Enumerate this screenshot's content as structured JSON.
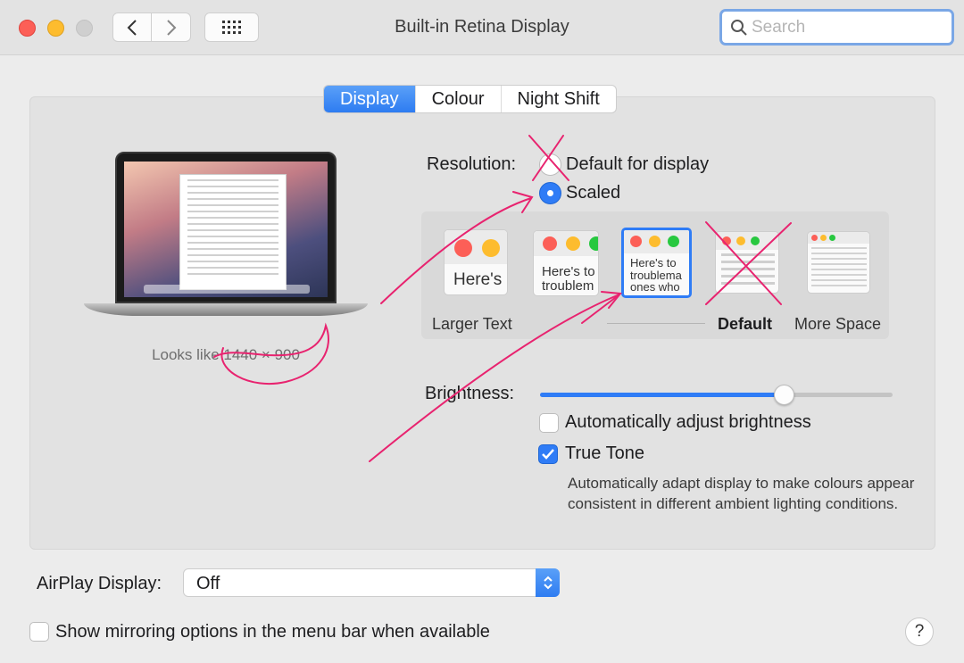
{
  "window": {
    "title": "Built-in Retina Display",
    "search_placeholder": "Search"
  },
  "tabs": [
    {
      "label": "Display",
      "active": true
    },
    {
      "label": "Colour",
      "active": false
    },
    {
      "label": "Night Shift",
      "active": false
    }
  ],
  "preview": {
    "looks_like": "Looks like 1440 × 900"
  },
  "resolution": {
    "label": "Resolution:",
    "options": [
      {
        "label": "Default for display",
        "selected": false
      },
      {
        "label": "Scaled",
        "selected": true
      }
    ]
  },
  "scaled_options": {
    "thumbs": [
      {
        "text": "Here's",
        "selected": false
      },
      {
        "text": "Here's to\ntroublem",
        "selected": false
      },
      {
        "text": "Here's to\ntroublema\nones who",
        "selected": true
      },
      {
        "text": "",
        "selected": false
      },
      {
        "text": "",
        "selected": false
      }
    ],
    "labels": [
      "Larger Text",
      "Default",
      "More Space"
    ]
  },
  "brightness": {
    "label": "Brightness:",
    "level": 0.69
  },
  "auto_brightness": {
    "label": "Automatically adjust brightness",
    "checked": false
  },
  "true_tone": {
    "label": "True Tone",
    "checked": true,
    "description": "Automatically adapt display to make colours appear consistent in different ambient lighting conditions."
  },
  "airplay": {
    "label": "AirPlay Display:",
    "value": "Off"
  },
  "mirroring": {
    "label": "Show mirroring options in the menu bar when available",
    "checked": false
  },
  "help": {
    "label": "?"
  },
  "colors": {
    "accent": "#2f7cf6",
    "annotation": "#e8236f"
  }
}
